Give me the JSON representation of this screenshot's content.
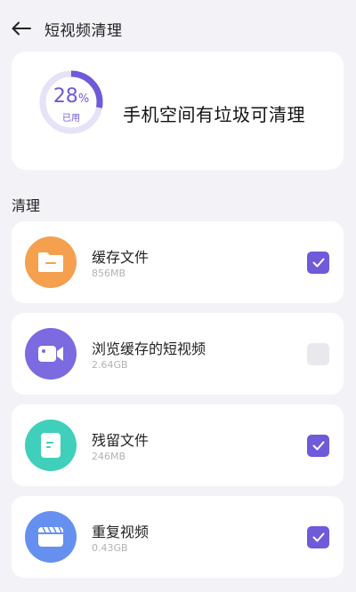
{
  "header": {
    "title": "短视频清理"
  },
  "summary": {
    "percent": "28",
    "percent_unit": "%",
    "used_label": "已用",
    "used_fraction": 0.28,
    "message": "手机空间有垃圾可清理"
  },
  "section": {
    "title": "清理"
  },
  "items": [
    {
      "name": "缓存文件",
      "size": "856MB",
      "checked": true,
      "icon": "folder-icon",
      "color": "#f5a04f"
    },
    {
      "name": "浏览缓存的短视频",
      "size": "2.64GB",
      "checked": false,
      "icon": "video-camera-icon",
      "color": "#7b6ae0"
    },
    {
      "name": "残留文件",
      "size": "246MB",
      "checked": true,
      "icon": "document-icon",
      "color": "#3fcfbb"
    },
    {
      "name": "重复视频",
      "size": "0.43GB",
      "checked": true,
      "icon": "clapperboard-icon",
      "color": "#6690f0"
    }
  ],
  "colors": {
    "accent": "#6f5ad9",
    "ring_track": "#e6e2f7"
  }
}
